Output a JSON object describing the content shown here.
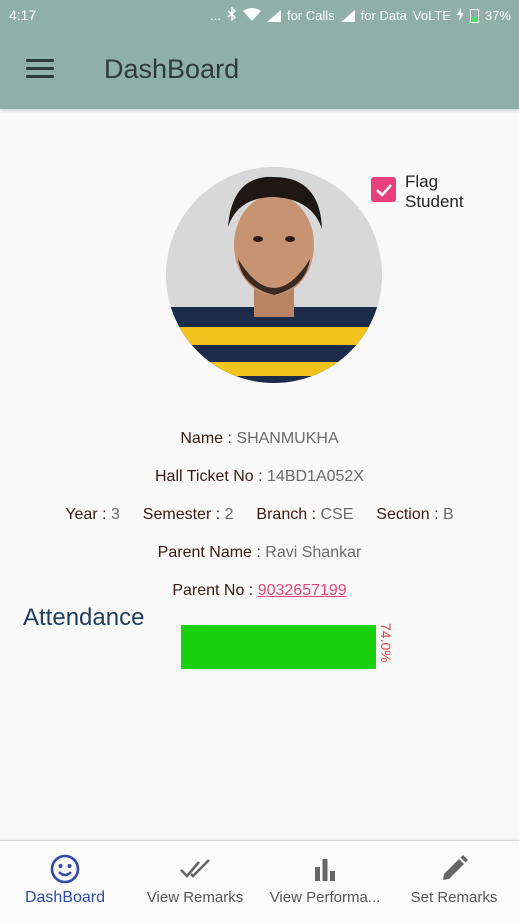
{
  "status_bar": {
    "time": "4:17",
    "dots": "...",
    "calls_label": "for Calls",
    "data_label": "for Data",
    "volte": "VoLTE",
    "battery": "37%"
  },
  "app_bar": {
    "title": "DashBoard"
  },
  "flag": {
    "label": "Flag Student",
    "checked": true
  },
  "student": {
    "name_label": "Name :",
    "name": "SHANMUKHA",
    "hall_ticket_label": "Hall Ticket No :",
    "hall_ticket": "14BD1A052X",
    "year_label": "Year :",
    "year": "3",
    "semester_label": "Semester :",
    "semester": "2",
    "branch_label": "Branch :",
    "branch": "CSE",
    "section_label": "Section :",
    "section": "B",
    "parent_name_label": "Parent Name :",
    "parent_name": "Ravi Shankar",
    "parent_no_label": "Parent No :",
    "parent_no": "9032657199"
  },
  "attendance": {
    "title": "Attendance",
    "percent_text": "74.0%",
    "fraction": 1.0,
    "color": "#1bd10f"
  },
  "bottom_nav": [
    {
      "label": "DashBoard",
      "icon": "smiley-face-icon",
      "active": true
    },
    {
      "label": "View Remarks",
      "icon": "double-check-icon",
      "active": false
    },
    {
      "label": "View Performa...",
      "icon": "bar-chart-icon",
      "active": false
    },
    {
      "label": "Set Remarks",
      "icon": "pencil-icon",
      "active": false
    }
  ],
  "colors": {
    "app_bar": "#8fb0a7",
    "accent_pink": "#e93f7c",
    "active_nav": "#2f4aa8"
  }
}
